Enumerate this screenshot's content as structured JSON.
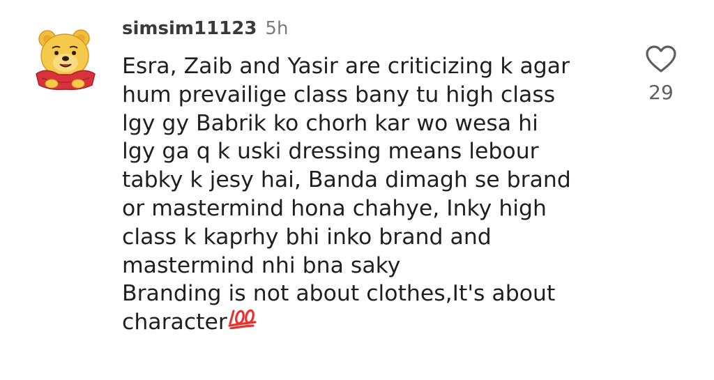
{
  "comment": {
    "username": "simsim11123",
    "time": "5h",
    "body_lines": [
      "Esra, Zaib and Yasir are criticizing k agar",
      "hum prevailige class bany tu high class",
      "lgy gy Babrik ko chorh kar wo wesa hi",
      "lgy ga q k uski dressing means lebour",
      "tabky k jesy hai, Banda dimagh se brand",
      "or mastermind hona chahye, Inky high",
      "class k kaprhy bhi inko brand and",
      "mastermind nhi bna saky",
      "Branding is not about clothes,It's about",
      "character"
    ],
    "emoji": "hundred-points-emoji",
    "likes": "29",
    "avatar": "winnie-the-pooh-avatar"
  },
  "colors": {
    "username": "#3a3a3a",
    "time": "#7a7a7a",
    "text": "#1f1f1f",
    "like_count": "#5e5e5e",
    "emoji": "#e8322f",
    "avatar_face": "#f4c542",
    "avatar_shirt": "#d8333a"
  }
}
